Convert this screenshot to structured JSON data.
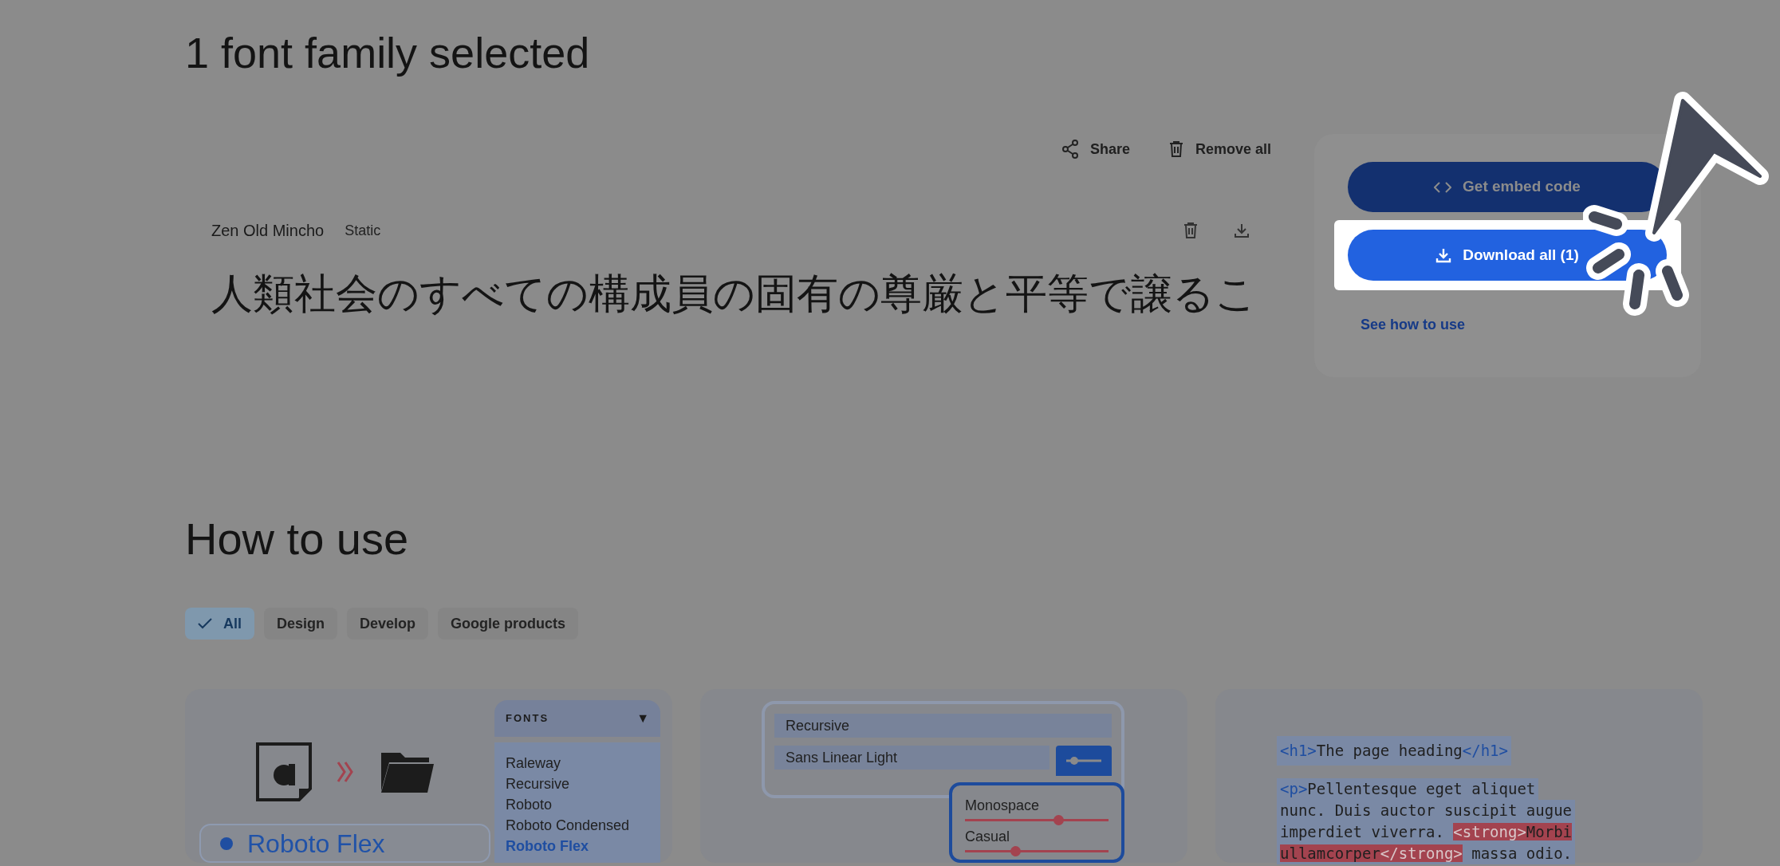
{
  "title": "1 font family selected",
  "actions": [
    {
      "kind": "share",
      "label": "Share"
    },
    {
      "kind": "remove",
      "label": "Remove all"
    }
  ],
  "family": {
    "name": "Zen Old Mincho",
    "style": "Static",
    "sample": "人類社会のすべての構成員の固有の尊厳と平等で譲るこ"
  },
  "panel": {
    "embed_button": "Get embed code",
    "download_button": "Download all (1)",
    "link": "See how to use"
  },
  "how_to_use": {
    "title": "How to use",
    "chips": [
      {
        "label": "All",
        "selected": true
      },
      {
        "label": "Design",
        "selected": false
      },
      {
        "label": "Develop",
        "selected": false
      },
      {
        "label": "Google products",
        "selected": false
      }
    ],
    "card_1": {
      "panel_title": "FONTS",
      "panel_caret": "▼",
      "fonts": [
        {
          "label": "Raleway",
          "selected": false
        },
        {
          "label": "Recursive",
          "selected": false
        },
        {
          "label": "Roboto",
          "selected": false
        },
        {
          "label": "Roboto Condensed",
          "selected": false
        },
        {
          "label": "Roboto Flex",
          "selected": true
        }
      ],
      "preview": "Roboto Flex"
    },
    "card_2": {
      "font_field": "Recursive",
      "style_field": "Sans Linear Light",
      "sliders": [
        {
          "label": "Monospace",
          "level": 0.65
        },
        {
          "label": "Casual",
          "level": 0.35
        }
      ]
    },
    "card_3": {
      "code_lines": [
        [
          {
            "kind": "tag",
            "text": "<h1>"
          },
          {
            "kind": "text",
            "text": "The page heading"
          },
          {
            "kind": "tag",
            "text": "</h1>"
          }
        ],
        [
          {
            "kind": "tag",
            "text": "<p>"
          },
          {
            "kind": "text",
            "text": "Pellentesque eget aliquet"
          }
        ],
        [
          {
            "kind": "text",
            "text": "nunc. Duis auctor suscipit augue"
          }
        ],
        [
          {
            "kind": "text",
            "text": "imperdiet viverra. "
          },
          {
            "kind": "strong_tag",
            "text": "<strong>"
          },
          {
            "kind": "strong_text",
            "text": "Morbi"
          }
        ],
        [
          {
            "kind": "strong_text",
            "text": "ullamcorper"
          },
          {
            "kind": "strong_tag",
            "text": "</strong>"
          },
          {
            "kind": "text",
            "text": " massa odio."
          }
        ]
      ]
    }
  }
}
